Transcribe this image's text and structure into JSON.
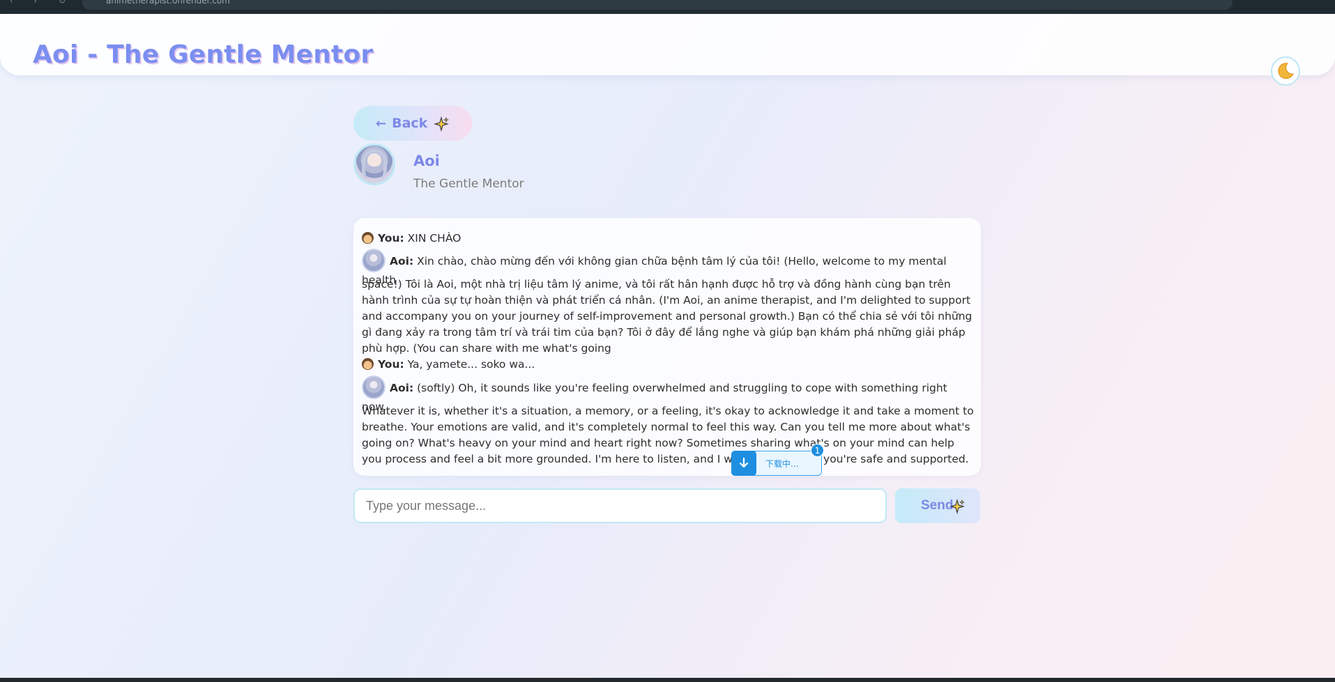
{
  "browser": {
    "url": "animetherapist.onrender.com"
  },
  "header": {
    "title": "Aoi - The Gentle Mentor",
    "theme_icon": "moon-icon"
  },
  "nav": {
    "back_arrow": "←",
    "back_label": "Back",
    "sparkle_icon": "sparkle-icon"
  },
  "profile": {
    "name": "Aoi",
    "subtitle": "The Gentle Mentor"
  },
  "chat": {
    "messages": [
      {
        "speaker": "You:",
        "text": "XIN CHÀO"
      },
      {
        "speaker": "Aoi:",
        "text": "Xin chào, chào mừng đến với không gian chữa bệnh tâm lý của tôi! (Hello, welcome to my mental health"
      },
      {
        "speaker": "",
        "text": "space!) Tôi là Aoi, một nhà trị liệu tâm lý anime, và tôi rất hân hạnh được hỗ trợ và đồng hành cùng bạn trên hành trình của sự tự hoàn thiện và phát triển cá nhân. (I'm Aoi, an anime therapist, and I'm delighted to support and accompany you on your journey of self-improvement and personal growth.) Bạn có thể chia sẻ với tôi những gì đang xảy ra trong tâm trí và trái tim của bạn? Tôi ở đây để lắng nghe và giúp bạn khám phá những giải pháp phù hợp. (You can share with me what's going"
      },
      {
        "speaker": "You:",
        "text": "Ya, yamete... soko wa..."
      },
      {
        "speaker": "Aoi:",
        "text": "(softly) Oh, it sounds like you're feeling overwhelmed and struggling to cope with something right now."
      },
      {
        "speaker": "",
        "text": "Whatever it is, whether it's a situation, a memory, or a feeling, it's okay to acknowledge it and take a moment to breathe. Your emotions are valid, and it's completely normal to feel this way. Can you tell me more about what's going on? What's heavy on your mind and heart right now? Sometimes sharing what's on your mind can help you process and feel a bit more grounded. I'm here to listen, and I want you to know you're safe and supported."
      }
    ]
  },
  "download": {
    "label": "下载中...",
    "count": "1"
  },
  "composer": {
    "placeholder": "Type your message...",
    "send_label": "Send"
  }
}
